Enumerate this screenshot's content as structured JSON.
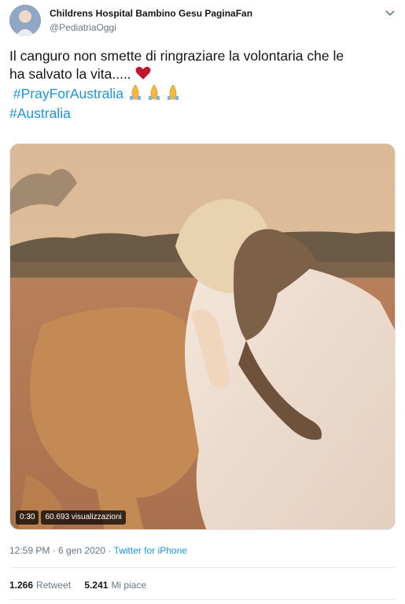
{
  "tweet": {
    "author": {
      "display_name": "Childrens Hospital Bambino Gesu PaginaFan",
      "handle": "@PediatriaOggi"
    },
    "text_line1": "Il canguro non smette di ringraziare la volontaria che le",
    "text_line2": "ha salvato la vita.....",
    "hashtag1": "#PrayForAustralia",
    "hashtag2": "#Australia",
    "icons": [
      "chevron-down-icon",
      "red-heart-emoji",
      "folded-hands-emoji"
    ],
    "video": {
      "duration": "0:30",
      "views": "60.693 visualizzazioni"
    },
    "timestamp": "12:59 PM · 6 gen 2020 · ",
    "source": "Twitter for iPhone",
    "stats": {
      "retweets_count": "1.266",
      "retweets_label": "Retweet",
      "likes_count": "5.241",
      "likes_label": "Mi piace"
    },
    "colors": {
      "link": "#1b95e0",
      "secondary_text": "#657786",
      "heart": "#c0172c"
    }
  }
}
